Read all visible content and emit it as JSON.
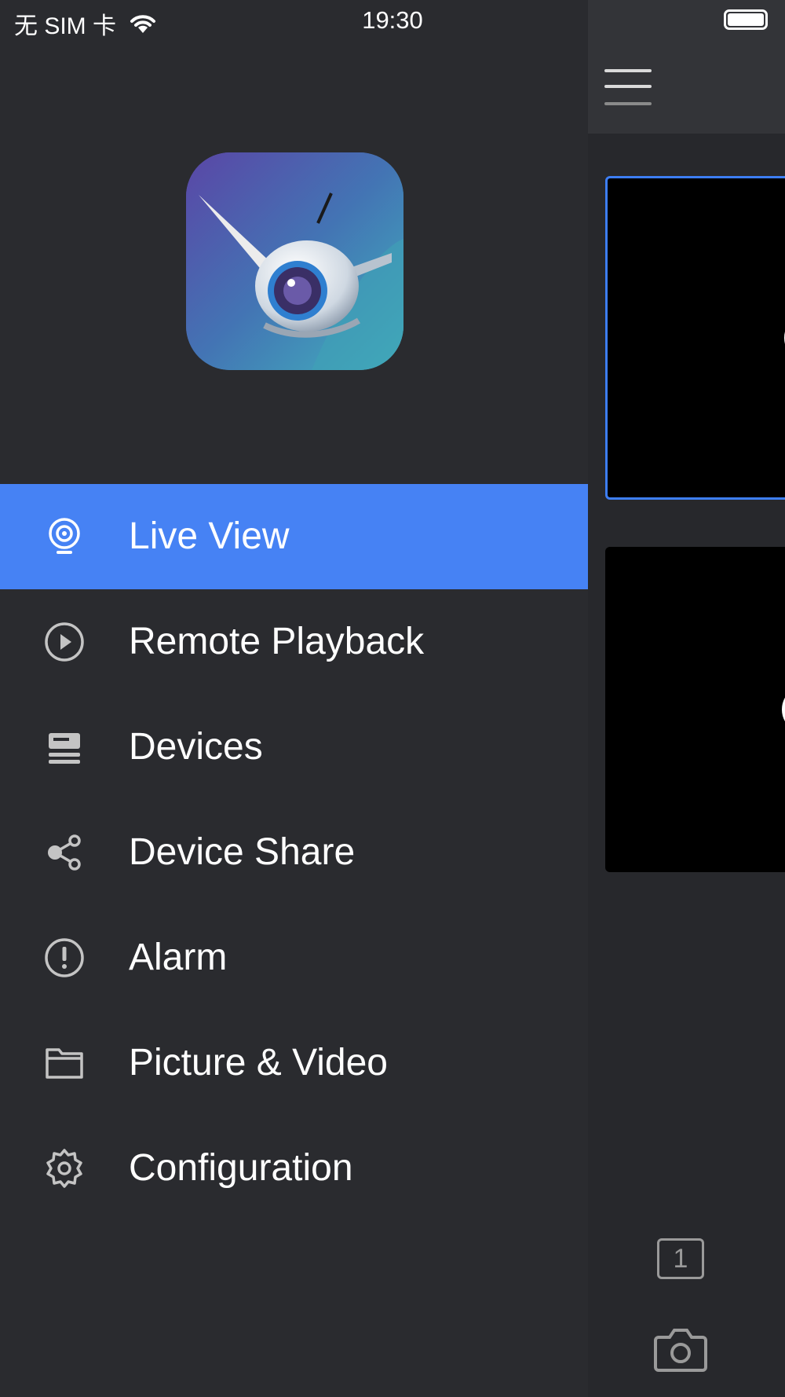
{
  "status_bar": {
    "carrier": "无 SIM 卡",
    "time": "19:30"
  },
  "drawer": {
    "logo_icon": "robot-camera-app-icon",
    "menu": [
      {
        "label": "Live View",
        "icon": "webcam-icon",
        "active": true
      },
      {
        "label": "Remote Playback",
        "icon": "play-circle-icon",
        "active": false
      },
      {
        "label": "Devices",
        "icon": "device-icon",
        "active": false
      },
      {
        "label": "Device Share",
        "icon": "share-icon",
        "active": false
      },
      {
        "label": "Alarm",
        "icon": "alarm-icon",
        "active": false
      },
      {
        "label": "Picture & Video",
        "icon": "folder-icon",
        "active": false
      },
      {
        "label": "Configuration",
        "icon": "gear-icon",
        "active": false
      }
    ]
  },
  "main": {
    "split_mode": "1",
    "colors": {
      "active_item": "#4682f4",
      "selected_border": "#3d7ef5",
      "drawer_bg": "#2a2b2f"
    }
  }
}
